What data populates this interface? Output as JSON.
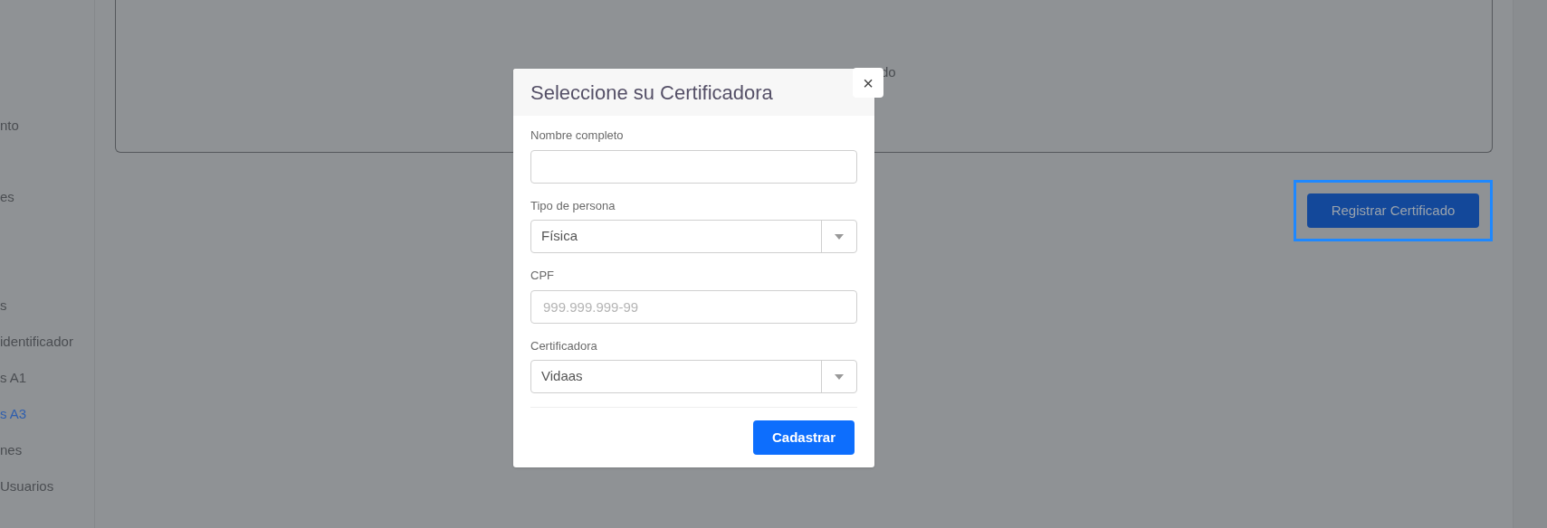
{
  "sidebar": {
    "items": [
      {
        "label": "nto",
        "selected": false
      },
      {
        "label": "es",
        "selected": false
      },
      {
        "label": "s",
        "selected": false
      },
      {
        "label": "identificador",
        "selected": false
      },
      {
        "label": "s A1",
        "selected": false
      },
      {
        "label": "s A3",
        "selected": true
      },
      {
        "label": "nes",
        "selected": false
      },
      {
        "label": "Usuarios",
        "selected": false
      }
    ]
  },
  "card": {
    "text_fragment": "do"
  },
  "register_button": {
    "label": "Registrar Certificado",
    "focused": true
  },
  "modal": {
    "title": "Seleccione su Certificadora",
    "close": "×",
    "fields": [
      {
        "kind": "text",
        "label": "Nombre completo"
      },
      {
        "kind": "select",
        "label": "Tipo de persona",
        "value": "Física"
      },
      {
        "kind": "text",
        "label": "CPF",
        "placeholder": "999.999.999-99"
      },
      {
        "kind": "select",
        "label": "Certificadora",
        "value": "Vidaas"
      }
    ],
    "submit": "Cadastrar"
  }
}
